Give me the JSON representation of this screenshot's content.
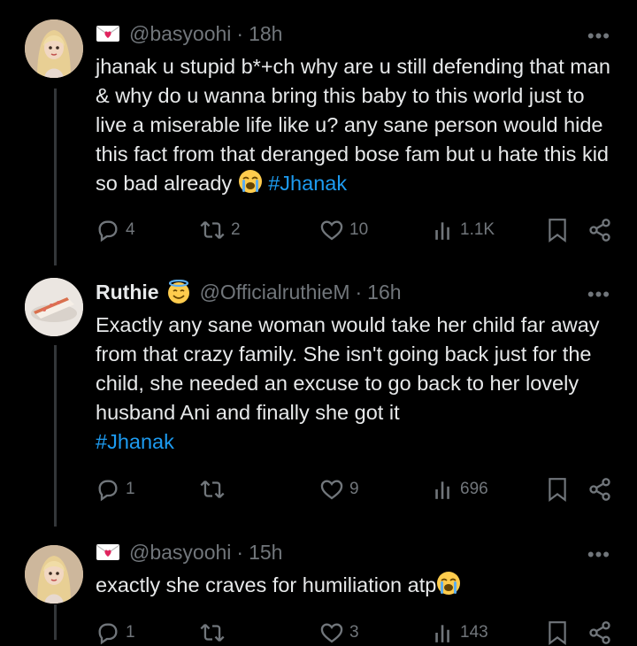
{
  "tweets": [
    {
      "handle": "@basyoohi",
      "time": "18h",
      "separator": "·",
      "text": "jhanak u stupid b*+ch why are u still defending that man & why do u wanna bring this baby to this world just to live a miserable life like u? any sane person would hide this fact from that deranged bose fam but u hate this kid so bad already",
      "hashtag": "#Jhanak",
      "replies": "4",
      "reposts": "2",
      "likes": "10",
      "views": "1.1K"
    },
    {
      "name": "Ruthie",
      "handle": "@OfficialruthieM",
      "time": "16h",
      "separator": "·",
      "text": "Exactly any sane woman would take her child far away from that crazy family. She isn't going back just for the child, she needed an excuse to go back to her lovely husband Ani and finally she got it",
      "hashtag": "#Jhanak",
      "replies": "1",
      "reposts": "",
      "likes": "9",
      "views": "696"
    },
    {
      "handle": "@basyoohi",
      "time": "15h",
      "separator": "·",
      "text": "exactly she craves for humiliation atp",
      "replies": "1",
      "reposts": "",
      "likes": "3",
      "views": "143"
    }
  ],
  "more_label": "•••",
  "colors": {
    "background": "#000000",
    "text": "#e7e9ea",
    "muted": "#71767b",
    "link": "#1d9bf0"
  },
  "icons": [
    "envelope-heart-icon",
    "loudly-crying-emoji",
    "smiling-halo-emoji",
    "reply-icon",
    "repost-icon",
    "like-icon",
    "views-icon",
    "bookmark-icon",
    "share-icon",
    "more-icon"
  ]
}
